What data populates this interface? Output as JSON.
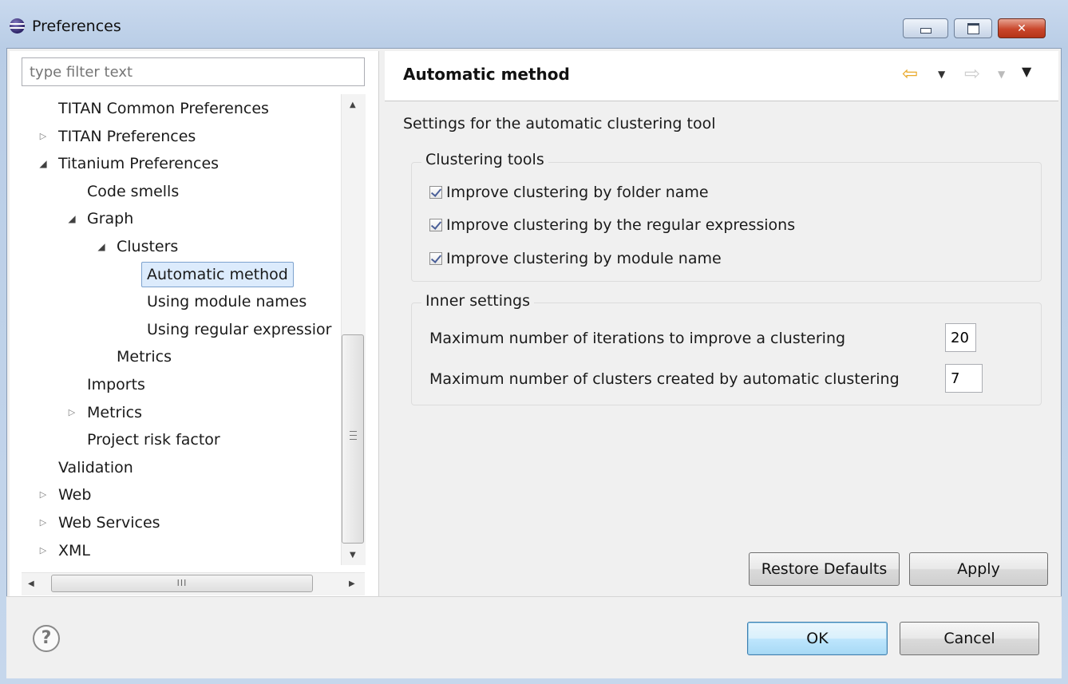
{
  "window": {
    "title": "Preferences",
    "controls": {
      "minimize": "minimize",
      "maximize": "maximize",
      "close": "close"
    }
  },
  "filter": {
    "placeholder": "type filter text",
    "value": ""
  },
  "tree": {
    "items": [
      {
        "label": "TITAN Common Preferences",
        "depth": 1,
        "expander": "none"
      },
      {
        "label": "TITAN Preferences",
        "depth": 1,
        "expander": "collapsed"
      },
      {
        "label": "Titanium Preferences",
        "depth": 1,
        "expander": "expanded"
      },
      {
        "label": "Code smells",
        "depth": 2,
        "expander": "none"
      },
      {
        "label": "Graph",
        "depth": 2,
        "expander": "expanded"
      },
      {
        "label": "Clusters",
        "depth": 3,
        "expander": "expanded"
      },
      {
        "label": "Automatic method",
        "depth": 4,
        "expander": "none",
        "selected": true
      },
      {
        "label": "Using module names",
        "depth": 4,
        "expander": "none"
      },
      {
        "label": "Using regular expressior",
        "depth": 4,
        "expander": "none"
      },
      {
        "label": "Metrics",
        "depth": 3,
        "expander": "none"
      },
      {
        "label": "Imports",
        "depth": 2,
        "expander": "none"
      },
      {
        "label": "Metrics",
        "depth": 2,
        "expander": "collapsed"
      },
      {
        "label": "Project risk factor",
        "depth": 2,
        "expander": "none"
      },
      {
        "label": "Validation",
        "depth": 1,
        "expander": "none"
      },
      {
        "label": "Web",
        "depth": 1,
        "expander": "collapsed"
      },
      {
        "label": "Web Services",
        "depth": 1,
        "expander": "collapsed"
      },
      {
        "label": "XML",
        "depth": 1,
        "expander": "collapsed"
      }
    ],
    "hscroll_thumb_label": "III"
  },
  "page": {
    "title": "Automatic method",
    "description": "Settings for the automatic clustering tool",
    "clustering_tools": {
      "label": "Clustering tools",
      "options": [
        {
          "label": "Improve clustering by folder name",
          "checked": true
        },
        {
          "label": "Improve clustering by the regular expressions",
          "checked": true
        },
        {
          "label": "Improve clustering by module name",
          "checked": true
        }
      ]
    },
    "inner_settings": {
      "label": "Inner settings",
      "max_iterations_label": "Maximum number of iterations to improve a clustering",
      "max_iterations_value": "20",
      "max_clusters_label": "Maximum number of clusters created by automatic clustering",
      "max_clusters_value": "7"
    },
    "restore_defaults": "Restore Defaults",
    "apply": "Apply"
  },
  "dialog": {
    "ok": "OK",
    "cancel": "Cancel",
    "help_glyph": "?"
  },
  "colors": {
    "accent_back_arrow": "#e9a92a",
    "selection_bg": "#dcebfc"
  }
}
